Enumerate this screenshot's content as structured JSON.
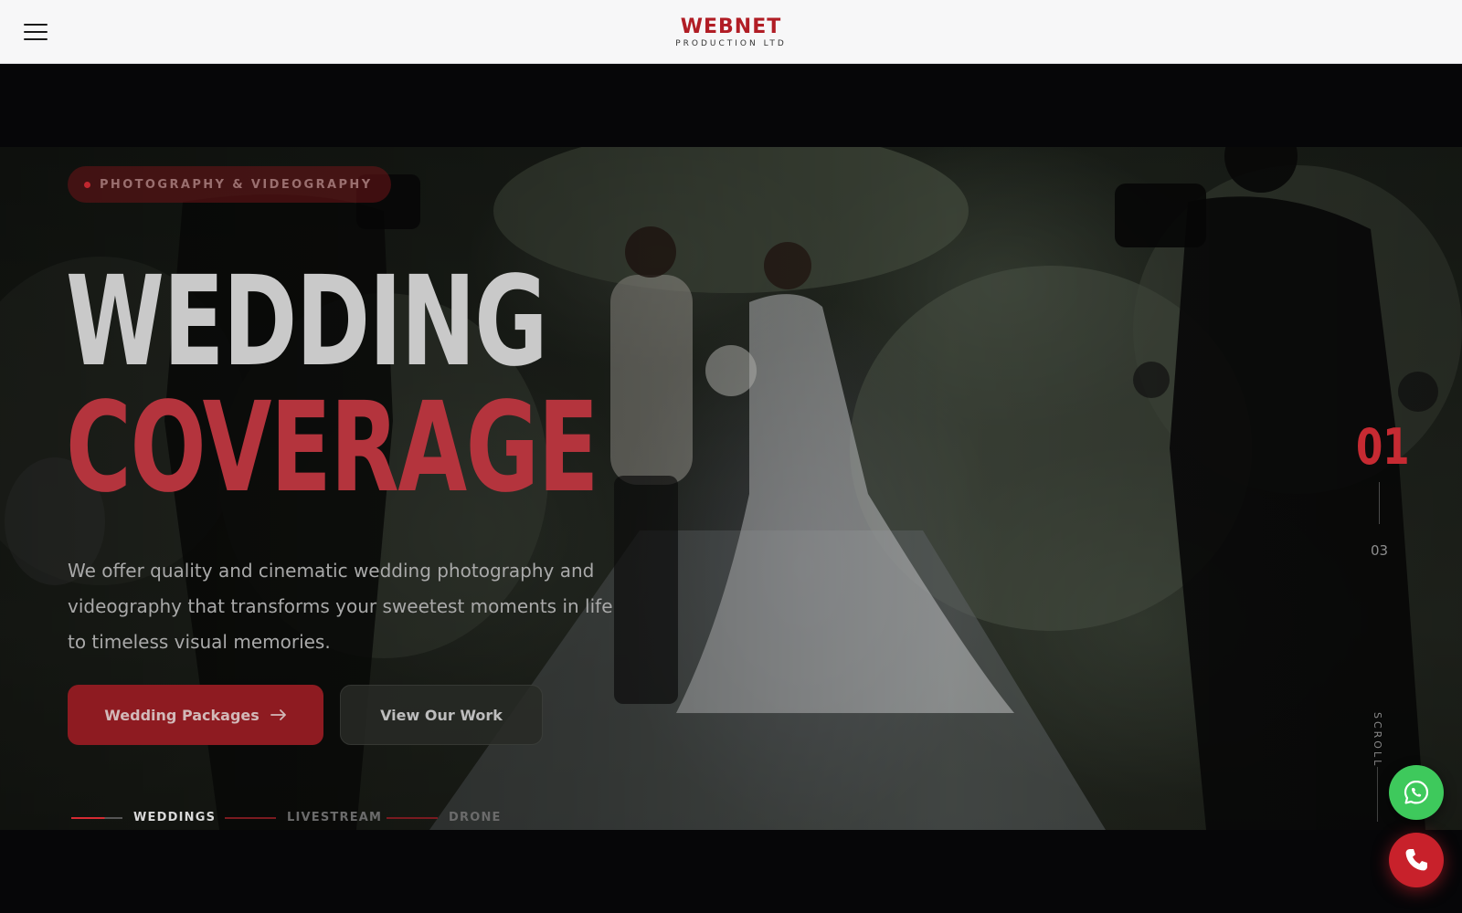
{
  "header": {
    "brand_name": "WEBNET",
    "brand_tagline": "PRODUCTION LTD",
    "brand_color": "#b11d25",
    "menu_icon": "hamburger-menu-icon"
  },
  "hero": {
    "tag": "PHOTOGRAPHY & VIDEOGRAPHY",
    "title_line1": "WEDDING",
    "title_line2": "COVERAGE",
    "accent_color": "#c62a32",
    "description": "We offer quality and cinematic wedding photography and videography that transforms your sweetest moments in life to timeless visual memories.",
    "primary_button": "Wedding Packages",
    "primary_button_icon": "arrow-right-icon",
    "secondary_button": "View Our Work",
    "background_image": "wedding ceremony photo"
  },
  "categories": [
    {
      "label": "WEDDINGS",
      "active": true
    },
    {
      "label": "LIVESTREAM",
      "active": false
    },
    {
      "label": "DRONE",
      "active": false
    }
  ],
  "slider": {
    "current": "01",
    "total": "03"
  },
  "scroll_label": "SCROLL",
  "floating_actions": {
    "whatsapp_icon": "whatsapp-icon",
    "whatsapp_color": "#3ec95c",
    "phone_icon": "phone-icon",
    "phone_color": "#c8212b"
  }
}
